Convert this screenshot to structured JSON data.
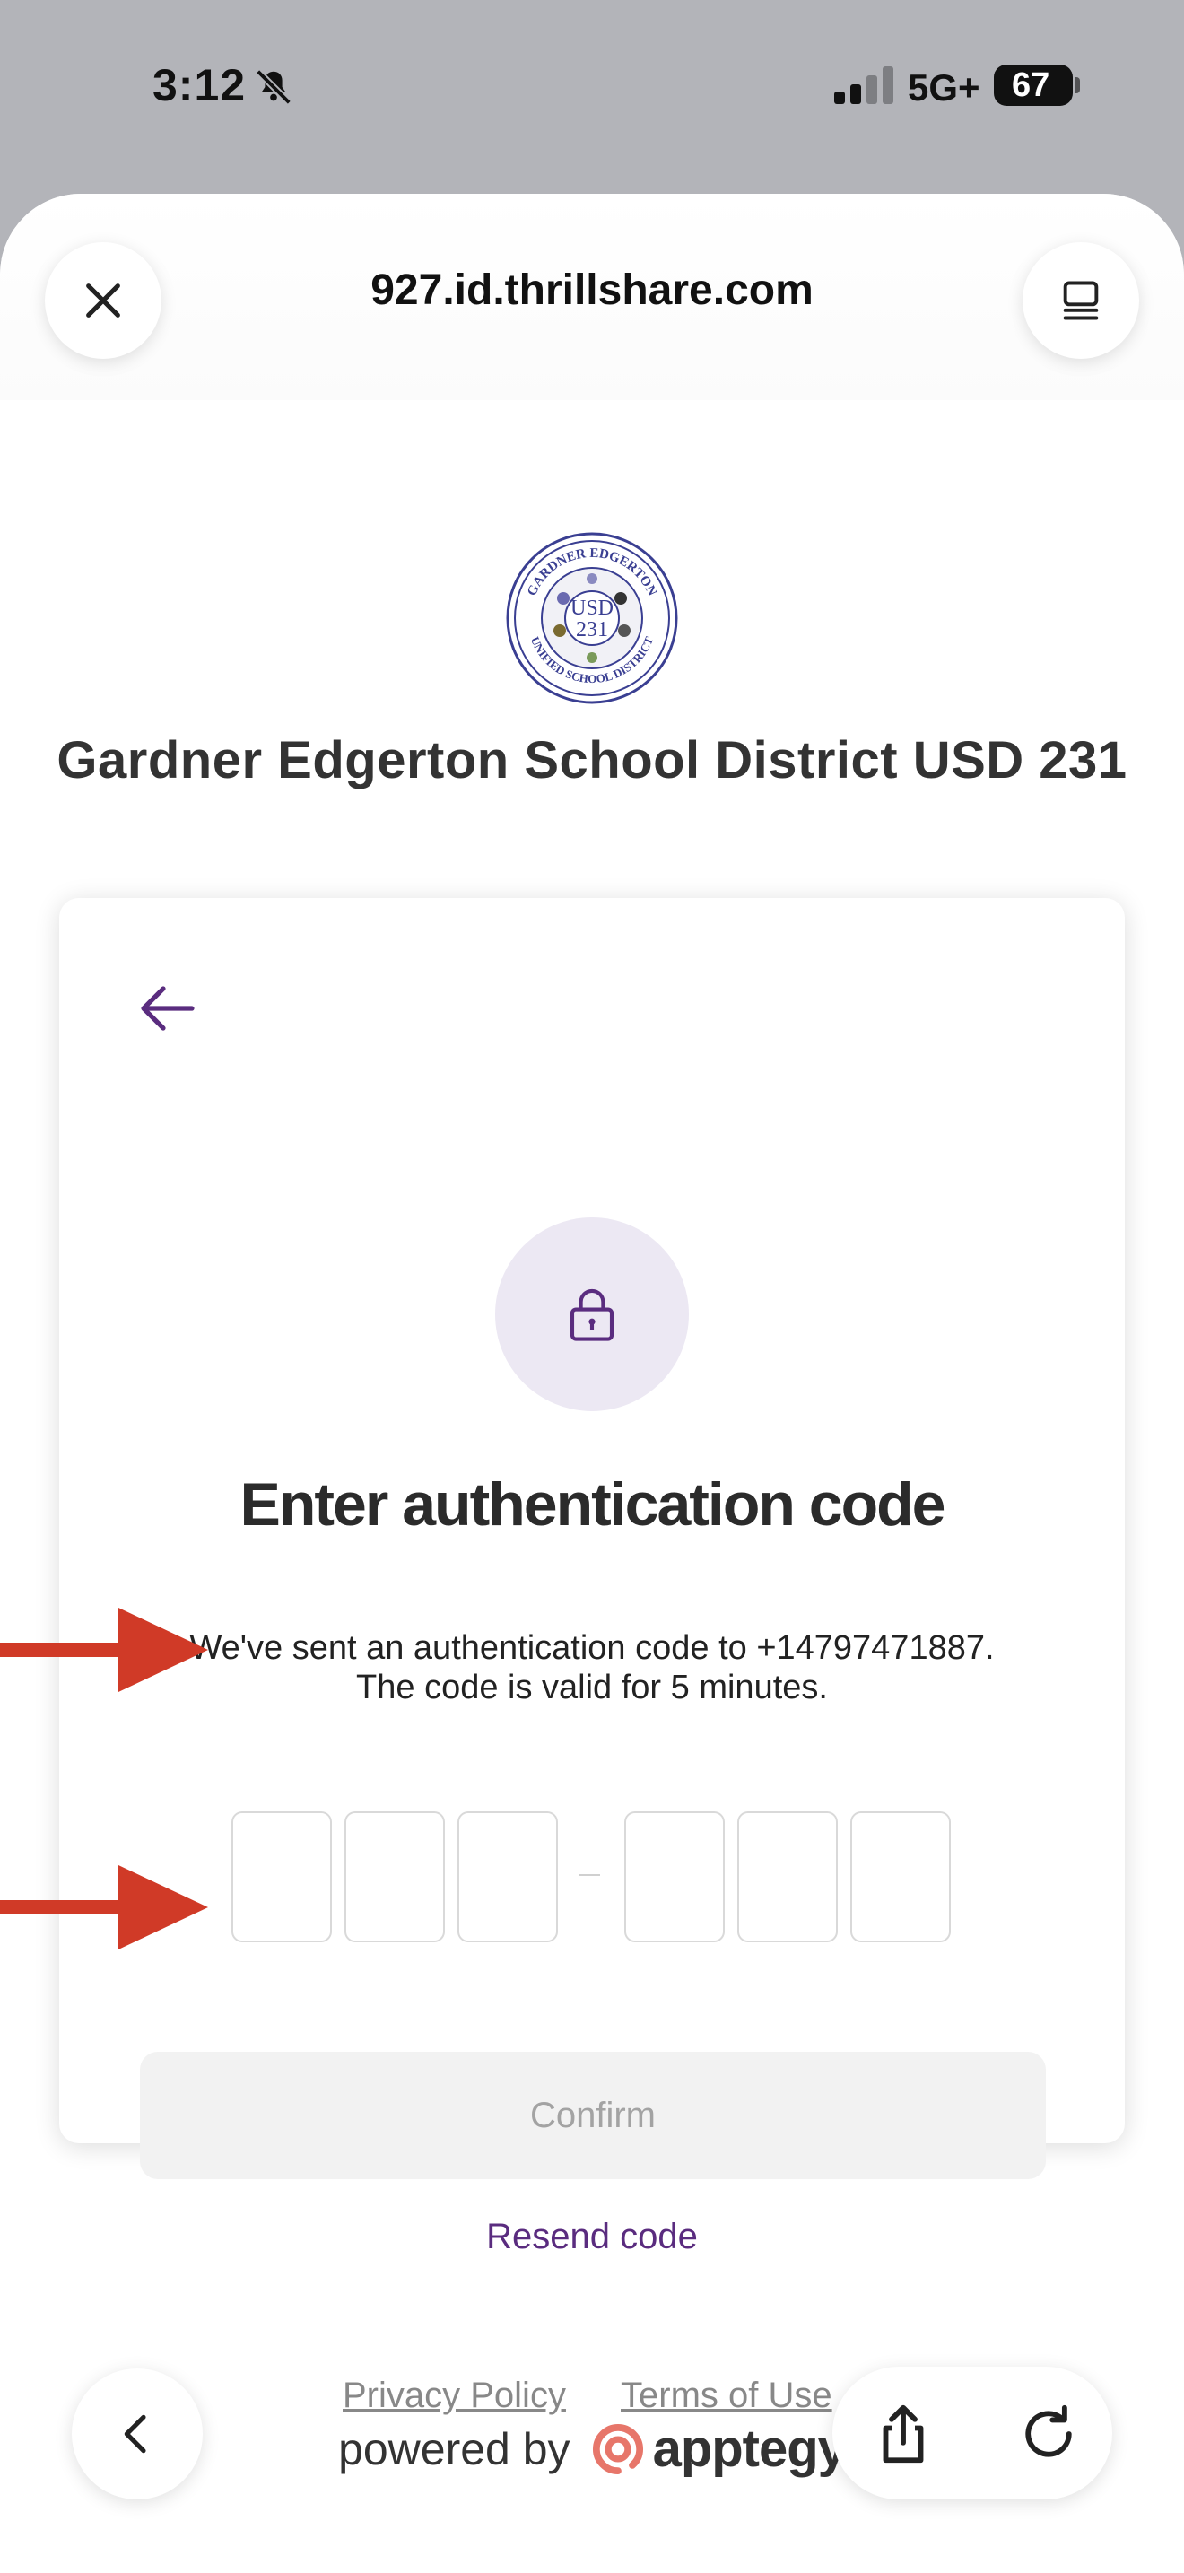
{
  "status_bar": {
    "time": "3:12",
    "network": "5G+",
    "battery": "67"
  },
  "browser": {
    "url": "927.id.thrillshare.com"
  },
  "page": {
    "logo_text": {
      "top": "GARDNER EDGERTON",
      "center_line1": "USD",
      "center_line2": "231",
      "bottom": "UNIFIED SCHOOL DISTRICT"
    },
    "district_name": "Gardner Edgerton School District USD 231",
    "heading": "Enter authentication code",
    "description_line1": "We've sent an authentication code to +14797471887.",
    "description_line2": "The code is valid for 5 minutes.",
    "confirm_label": "Confirm",
    "resend_label": "Resend code",
    "powered_by": "powered by",
    "brand": "apptegy",
    "privacy_label": "Privacy Policy",
    "terms_label": "Terms of Use"
  },
  "colors": {
    "accent": "#5a2c7f",
    "annotation_arrow": "#d03a27",
    "brand_mark": "#e7766a"
  }
}
